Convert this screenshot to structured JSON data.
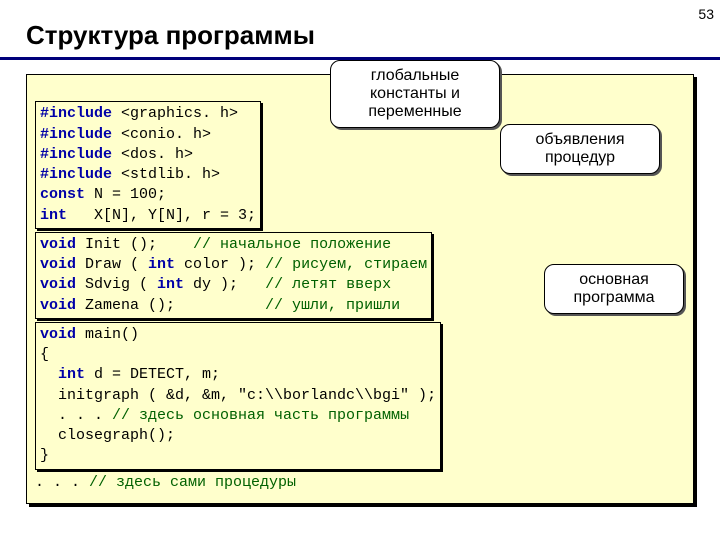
{
  "page_number": "53",
  "title": "Структура программы",
  "callouts": {
    "c1": "глобальные константы и переменные",
    "c2": "объявления процедур",
    "c3": "основная программа"
  },
  "code": {
    "inc1_kw": "#include",
    "inc1_rest": " <graphics. h>",
    "inc2_kw": "#include",
    "inc2_rest": " <conio. h>",
    "inc3_kw": "#include",
    "inc3_rest": " <dos. h>",
    "inc4_kw": "#include",
    "inc4_rest": " <stdlib. h>",
    "l5_a": "const",
    "l5_b": " N = 100;",
    "l6_a": "int",
    "l6_b": "   X[N], Y[N], r = 3;",
    "l7_a": "void",
    "l7_b": " Init ();    ",
    "l7_c": "// начальное положение",
    "l8_a": "void",
    "l8_b": " Draw ( ",
    "l8_c": "int",
    "l8_d": " color ); ",
    "l8_e": "// рисуем, стираем",
    "l9_a": "void",
    "l9_b": " Sdvig ( ",
    "l9_c": "int",
    "l9_d": " dy );   ",
    "l9_e": "// летят вверх",
    "l10_a": "void",
    "l10_b": " Zamena ();          ",
    "l10_c": "// ушли, пришли",
    "l11_a": "void",
    "l11_b": " main()",
    "l12": "{",
    "l13_a": "int",
    "l13_b": " d = DETECT, m;",
    "l13_pad": "  ",
    "l14": "  initgraph ( &d, &m, \"c:\\\\borlandc\\\\bgi\" );",
    "l15_a": "  . . . ",
    "l15_b": "// здесь основная часть программы",
    "l16": "  closegraph();",
    "l17": "}",
    "l18_a": ". . . ",
    "l18_b": "// здесь сами процедуры"
  }
}
